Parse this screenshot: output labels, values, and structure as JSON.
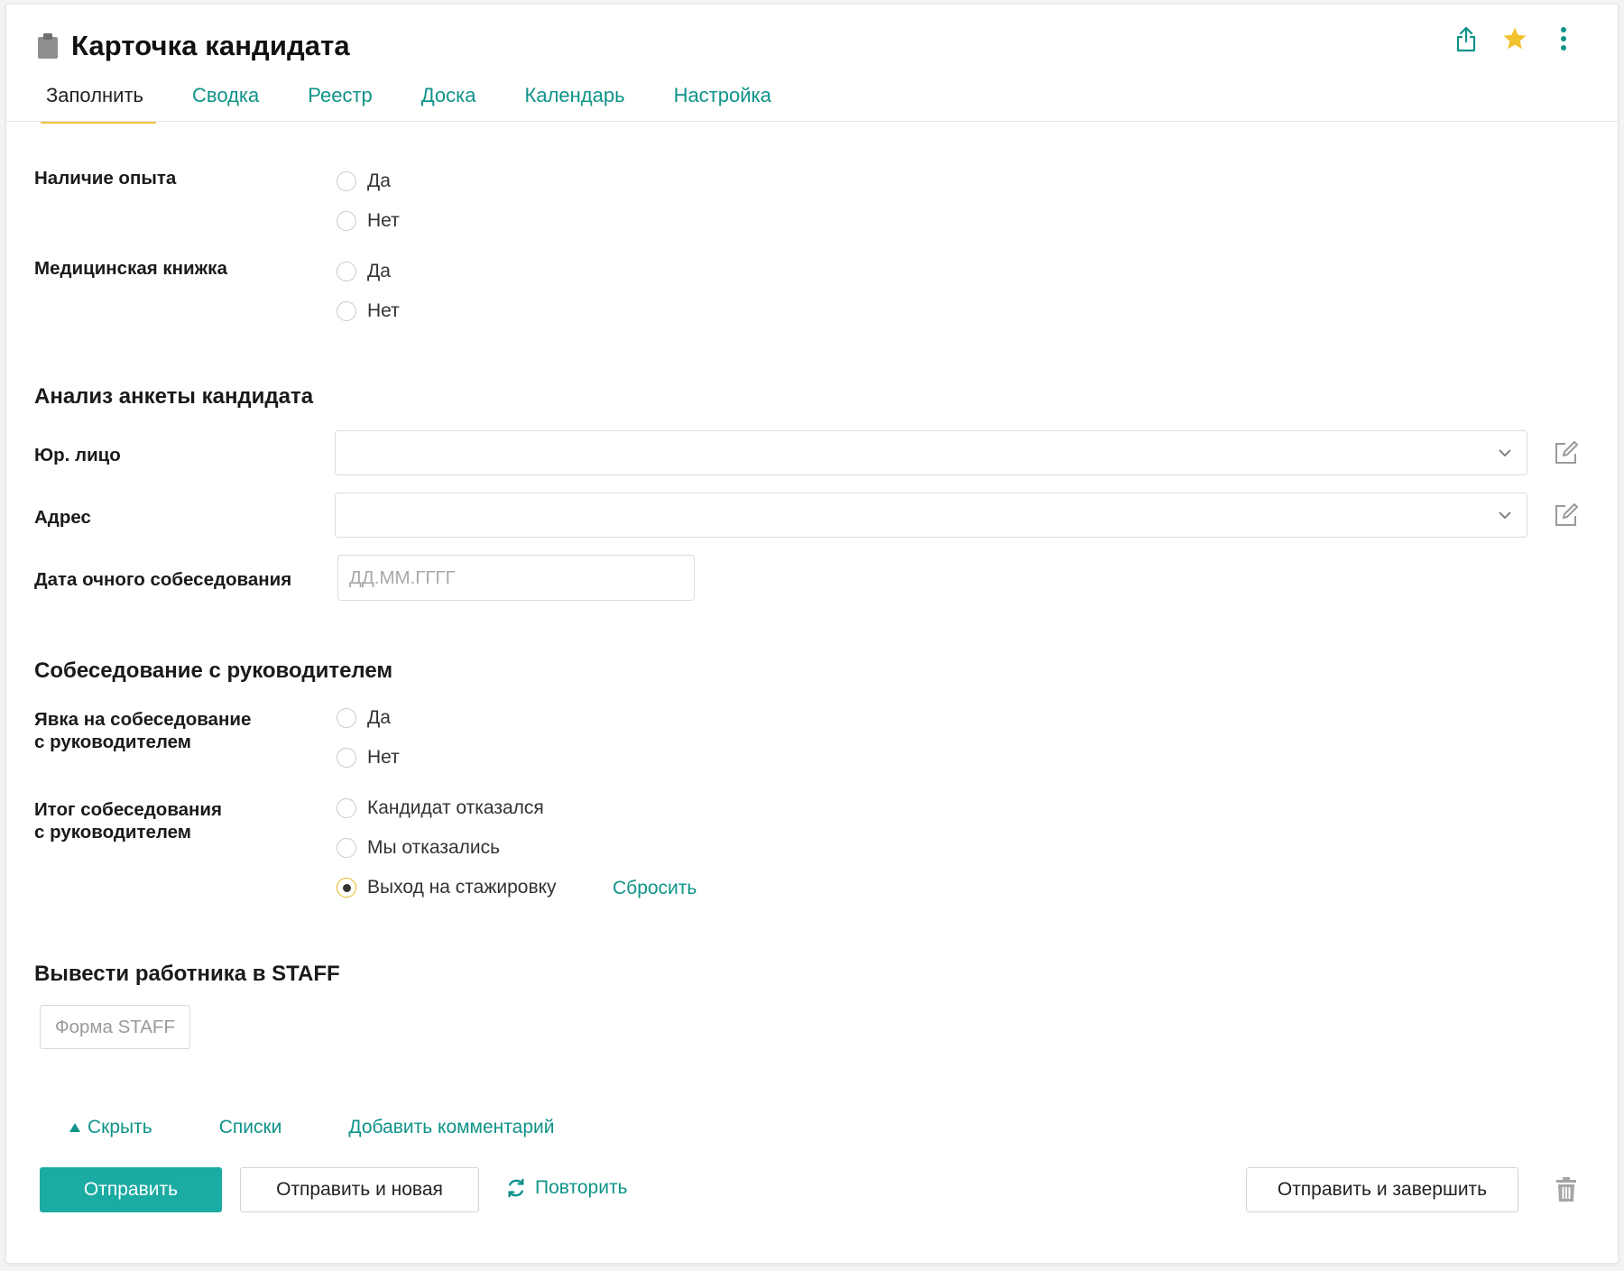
{
  "header": {
    "title": "Карточка кандидата",
    "icons": [
      "clipboard-icon",
      "share-icon",
      "star-icon",
      "more-vert-icon"
    ]
  },
  "tabs": [
    {
      "label": "Заполнить",
      "active": true
    },
    {
      "label": "Сводка"
    },
    {
      "label": "Реестр"
    },
    {
      "label": "Доска"
    },
    {
      "label": "Календарь"
    },
    {
      "label": "Настройка"
    }
  ],
  "form": {
    "experience": {
      "label": "Наличие опыта",
      "options": [
        "Да",
        "Нет"
      ]
    },
    "med_book": {
      "label": "Медицинская книжка",
      "options": [
        "Да",
        "Нет"
      ]
    },
    "analysis_section": "Анализ анкеты кандидата",
    "legal_entity": {
      "label": "Юр. лицо",
      "value": ""
    },
    "address": {
      "label": "Адрес",
      "value": ""
    },
    "interview_date": {
      "label": "Дата очного собеседования",
      "placeholder": "ДД.ММ.ГГГГ",
      "value": ""
    },
    "manager_section": "Собеседование с руководителем",
    "attendance": {
      "label_line1": "Явка на собеседование",
      "label_line2": "с руководителем",
      "options": [
        "Да",
        "Нет"
      ]
    },
    "result": {
      "label_line1": "Итог собеседования",
      "label_line2": "с руководителем",
      "options": [
        "Кандидат отказался",
        "Мы отказались",
        "Выход на стажировку"
      ],
      "selected": "Выход на стажировку",
      "reset_label": "Сбросить"
    },
    "staff_section": "Вывести работника в STAFF",
    "staff_button": "Форма STAFF"
  },
  "footer": {
    "hide_label": "Скрыть",
    "lists_label": "Списки",
    "comment_label": "Добавить комментарий",
    "submit_label": "Отправить",
    "submit_new_label": "Отправить и новая",
    "repeat_label": "Повторить",
    "submit_finish_label": "Отправить и завершить"
  },
  "colors": {
    "accent": "#1aaba3",
    "link": "#0f9389",
    "tab_underline": "#f0c23b",
    "star": "#f2c12e"
  }
}
